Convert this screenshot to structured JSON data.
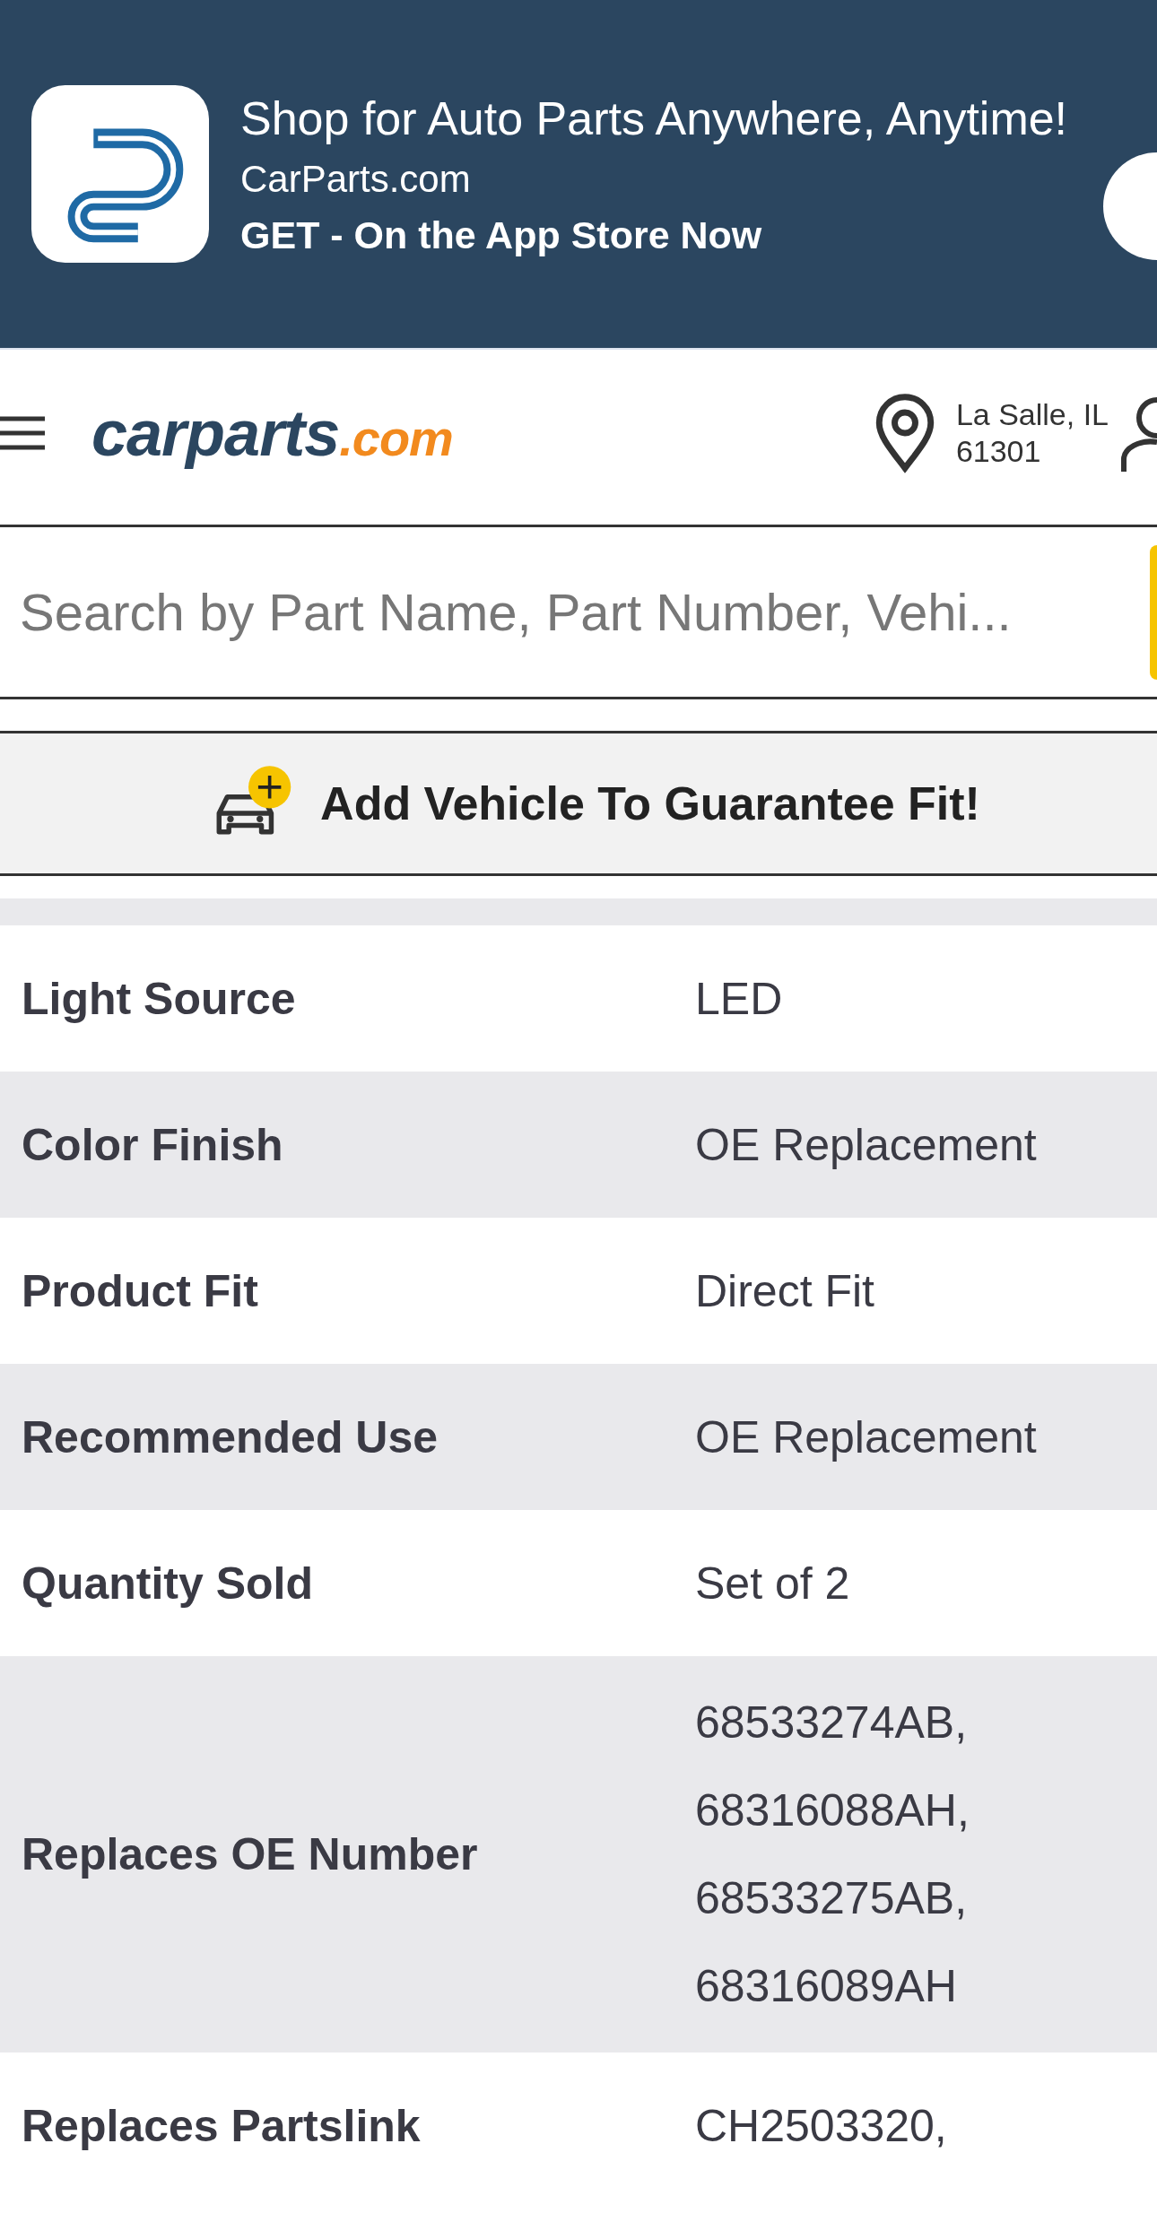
{
  "app_banner": {
    "title": "Shop for Auto Parts Anywhere, Anytime!",
    "publisher": "CarParts.com",
    "cta": "GET - On the App Store Now"
  },
  "header": {
    "logo": {
      "name": "carparts",
      "suffix": ".com"
    },
    "location": {
      "city": "La Salle, IL",
      "zip": "61301"
    }
  },
  "search": {
    "placeholder": "Search by Part Name, Part Number, Vehi..."
  },
  "add_vehicle": {
    "label": "Add Vehicle To Guarantee Fit!"
  },
  "specs": [
    {
      "label": "Light Source",
      "value": [
        "LED"
      ]
    },
    {
      "label": "Color Finish",
      "value": [
        "OE Replacement"
      ]
    },
    {
      "label": "Product Fit",
      "value": [
        "Direct Fit"
      ]
    },
    {
      "label": "Recommended Use",
      "value": [
        "OE Replacement"
      ]
    },
    {
      "label": "Quantity Sold",
      "value": [
        "Set of 2"
      ]
    },
    {
      "label": "Replaces OE Number",
      "value": [
        "68533274AB,",
        "68316088AH,",
        "68533275AB,",
        "68316089AH"
      ]
    },
    {
      "label": "Replaces Partslink",
      "value": [
        "CH2503320,"
      ]
    }
  ]
}
